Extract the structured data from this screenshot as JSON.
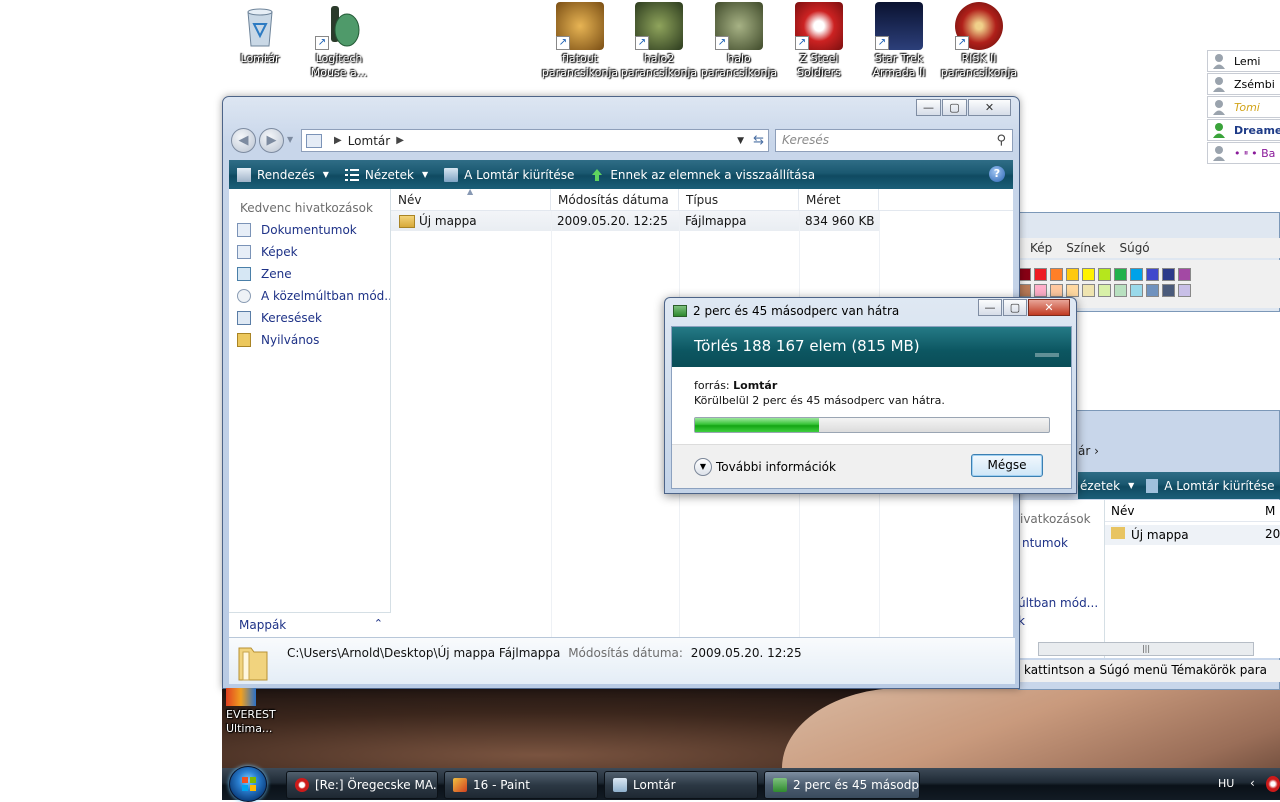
{
  "desktop": {
    "icons": [
      {
        "label": "Lomtár",
        "color": "#b0c8dc"
      },
      {
        "label": "Logitech Mouse a...",
        "color": "#4f9a6a"
      },
      {
        "label": "flatout parancsikonja",
        "color": "#c08a30"
      },
      {
        "label": "halo2 parancsikonja",
        "color": "#5a6e3a"
      },
      {
        "label": "halo parancsikonja",
        "color": "#6f7b4f"
      },
      {
        "label": "Z Steel Soldiers",
        "color": "#cc2222"
      },
      {
        "label": "Star Trek Armada II",
        "color": "#1c2a5a"
      },
      {
        "label": "RISK II parancsikonja",
        "color": "#b0201a"
      }
    ],
    "bottom_icon": {
      "label": "EVEREST Ultima..."
    }
  },
  "contacts": [
    {
      "name": "Lemi",
      "status": "offline"
    },
    {
      "name": "Zsémbi",
      "status": "offline"
    },
    {
      "name": "Tomi",
      "status": "offline"
    },
    {
      "name": "Dreamer",
      "status": "online"
    },
    {
      "name": "• ײ • Ba",
      "status": "offline"
    }
  ],
  "paint": {
    "menu": [
      "Kép",
      "Színek",
      "Súgó"
    ]
  },
  "bg_explorer": {
    "path_fragment": "ár",
    "toolbar_fragment": "ézetek",
    "empty_label": "A Lomtár kiürítése",
    "left_fragments": [
      "ivatkozások",
      "ntumok",
      "últban mód...",
      "k"
    ],
    "col_name": "Név",
    "col_frag": "M",
    "row_name": "Új mappa",
    "row_frag": "20",
    "status": "kattintson a Súgó menü Témakörök para",
    "scroll_grip": "|||"
  },
  "explorer": {
    "address": "Lomtár",
    "search_placeholder": "Keresés",
    "toolbar": {
      "organize": "Rendezés",
      "views": "Nézetek",
      "empty_bin": "A Lomtár kiürítése",
      "restore_all": "Ennek az elemnek a visszaállítása"
    },
    "left": {
      "heading": "Kedvenc hivatkozások",
      "favorites": [
        "Dokumentumok",
        "Képek",
        "Zene",
        "A közelmúltban mód...",
        "Keresések",
        "Nyilvános"
      ],
      "folders": "Mappák"
    },
    "columns": [
      "Név",
      "Módosítás dátuma",
      "Típus",
      "Méret"
    ],
    "rows": [
      {
        "name": "Új mappa",
        "modified": "2009.05.20. 12:25",
        "type": "Fájlmappa",
        "size": "834 960 KB"
      }
    ],
    "details": {
      "path": "C:\\Users\\Arnold\\Desktop\\Új mappa Fájlmappa",
      "modified_label": "Módosítás dátuma:",
      "modified_value": "2009.05.20. 12:25"
    }
  },
  "dialog": {
    "title": "2 perc és 45 másodperc van hátra",
    "heading": "Törlés 188 167 elem (815 MB)",
    "source_label": "forrás:",
    "source_value": "Lomtár",
    "remaining": "Körülbelül 2 perc és 45 másodperc van hátra.",
    "progress": 0.35,
    "more_info": "További információk",
    "cancel": "Mégse"
  },
  "taskbar": {
    "tasks": [
      {
        "label": "[Re:] Öregecske MA...",
        "active": false
      },
      {
        "label": "16 - Paint",
        "active": false
      },
      {
        "label": "Lomtár",
        "active": false
      },
      {
        "label": "2 perc és 45 másodp...",
        "active": true
      }
    ],
    "language": "HU"
  },
  "colors": {
    "toolbar_teal": "#1a5870",
    "link_blue": "#1e3287",
    "progress_green": "#37c437"
  }
}
